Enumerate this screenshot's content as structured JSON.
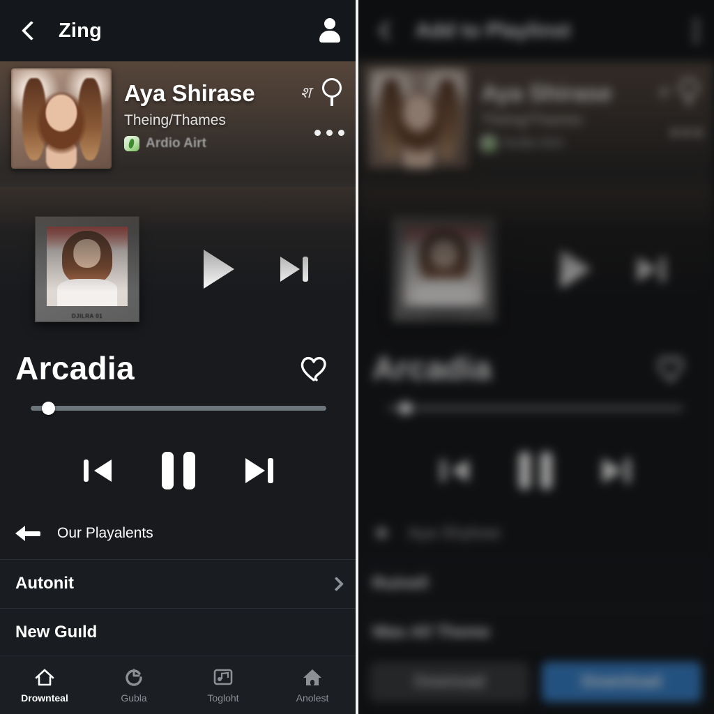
{
  "left": {
    "header": {
      "back_icon": "chevron-left-icon",
      "title": "Zing",
      "account_icon": "person-icon"
    },
    "banner": {
      "artist_name": "Aya Shirase",
      "artist_subtitle": "Theing/Thames",
      "app_label": "Ardio Airt",
      "script_glyph": "श",
      "search_icon": "search-icon",
      "more_icon": "more-horizontal-icon"
    },
    "player": {
      "album_caption": "DJILRA 01",
      "play_icon": "play-icon",
      "next_icon": "skip-next-icon",
      "track_title": "Arcadia",
      "favorite_icon": "heart-icon",
      "progress_percent": 6,
      "prev_icon": "skip-previous-icon",
      "pause_icon": "pause-icon"
    },
    "list": {
      "back_row_label": "Our Playalents",
      "rows": [
        {
          "label": "Autonit",
          "chevron": "chevron-right-icon"
        },
        {
          "label": "New Guıld",
          "chevron": ""
        }
      ]
    },
    "bottom_nav": [
      {
        "label": "Drownteal",
        "icon": "home-outline-icon",
        "active": true
      },
      {
        "label": "Gubla",
        "icon": "refresh-icon",
        "active": false
      },
      {
        "label": "Togloht",
        "icon": "card-icon",
        "active": false
      },
      {
        "label": "Anolest",
        "icon": "home-filled-icon",
        "active": false
      }
    ]
  },
  "right": {
    "header": {
      "back_icon": "chevron-left-icon",
      "title": "Add to Playlinst",
      "menu_icon": "more-vertical-icon"
    },
    "banner": {
      "artist_name": "Aya Shirase",
      "artist_subtitle": "Theing/Thames",
      "app_label": "Ardio Airt",
      "script_glyph": "श",
      "search_icon": "search-icon",
      "more_icon": "more-horizontal-icon"
    },
    "player": {
      "album_caption": "DJILRA 01",
      "play_icon": "play-icon",
      "next_icon": "skip-next-icon",
      "track_title": "Arcadia",
      "favorite_icon": "heart-icon",
      "progress_percent": 6,
      "prev_icon": "skip-previous-icon",
      "pause_icon": "pause-icon"
    },
    "list": {
      "star_row_label": "Aya Shylose",
      "rows": [
        {
          "label": "Ruinell",
          "chevron": ""
        },
        {
          "label": "Was All Theme",
          "chevron": ""
        }
      ]
    },
    "actions": {
      "secondary_label": "Downoad",
      "primary_label": "Download"
    }
  },
  "colors": {
    "accent_blue": "#1e87f0",
    "panel_bg": "#181a1e",
    "appbar_bg": "#14171b",
    "row_bg": "#191c21",
    "divider": "#f2f2f2",
    "muted_text": "#8d9196"
  }
}
